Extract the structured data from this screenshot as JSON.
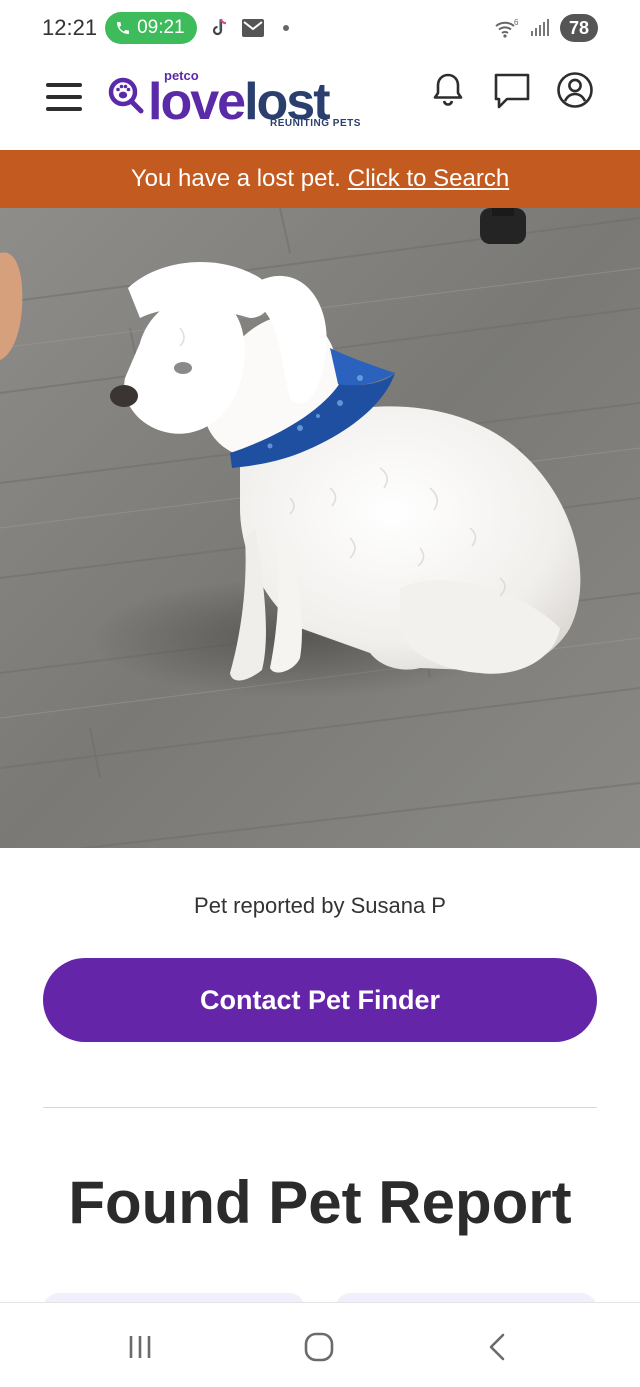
{
  "status_bar": {
    "time": "12:21",
    "call_duration": "09:21",
    "battery": "78",
    "call_color": "#3ebb5b"
  },
  "header": {
    "logo": {
      "petco": "petco",
      "love": "love",
      "lost": "lost",
      "tagline": "REUNITING PETS"
    },
    "icons": [
      "menu-icon",
      "bell-icon",
      "chat-icon",
      "account-icon"
    ]
  },
  "banner": {
    "text": "You have a lost pet.",
    "link": "Click to Search",
    "color": "#c35a1f"
  },
  "photo": {
    "subject": "white dog with blue bandana"
  },
  "report": {
    "reported_by": "Pet reported by Susana P",
    "contact_button": "Contact Pet Finder",
    "section_title": "Found Pet Report",
    "accent": "#6525a8"
  },
  "nav_bar": {
    "icons": [
      "recent-apps-icon",
      "home-icon",
      "back-icon"
    ]
  }
}
